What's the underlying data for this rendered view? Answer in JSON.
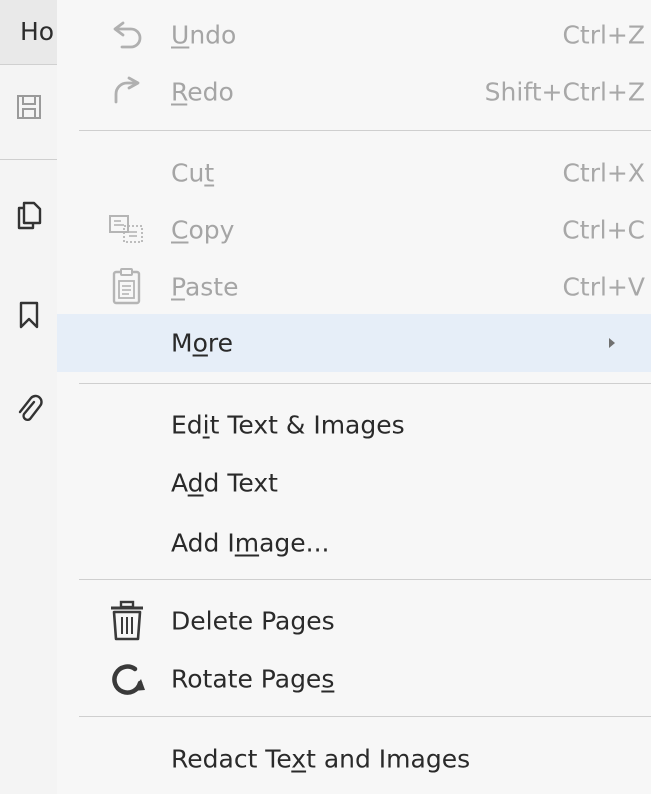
{
  "app": {
    "home_tab_label": "Ho",
    "strip_icons": [
      "save-icon",
      "pages-icon",
      "bookmark-icon",
      "attachment-icon"
    ]
  },
  "menu": {
    "items": [
      {
        "pre": "",
        "key": "U",
        "post": "ndo",
        "shortcut": "Ctrl+Z",
        "icon": "undo-icon",
        "disabled": true
      },
      {
        "pre": "",
        "key": "R",
        "post": "edo",
        "shortcut": "Shift+Ctrl+Z",
        "icon": "redo-icon",
        "disabled": true
      },
      {
        "pre": "Cu",
        "key": "t",
        "post": "",
        "shortcut": "Ctrl+X",
        "icon": "",
        "disabled": true
      },
      {
        "pre": "",
        "key": "C",
        "post": "opy",
        "shortcut": "Ctrl+C",
        "icon": "copy-icon",
        "disabled": true
      },
      {
        "pre": "",
        "key": "P",
        "post": "aste",
        "shortcut": "Ctrl+V",
        "icon": "paste-icon",
        "disabled": true
      },
      {
        "pre": "M",
        "key": "o",
        "post": "re",
        "shortcut": "",
        "icon": "",
        "disabled": false,
        "submenu": true,
        "highlighted": true
      },
      {
        "pre": "Ed",
        "key": "i",
        "post": "t Text & Images",
        "shortcut": "",
        "icon": "",
        "disabled": false
      },
      {
        "pre": "A",
        "key": "d",
        "post": "d Text",
        "shortcut": "",
        "icon": "",
        "disabled": false
      },
      {
        "pre": "Add I",
        "key": "m",
        "post": "age...",
        "shortcut": "",
        "icon": "",
        "disabled": false
      },
      {
        "pre": "Delete Pages",
        "key": "",
        "post": "",
        "shortcut": "",
        "icon": "trash-icon",
        "disabled": false
      },
      {
        "pre": "Rotate Page",
        "key": "s",
        "post": "",
        "shortcut": "",
        "icon": "rotate-icon",
        "disabled": false
      },
      {
        "pre": "Redact Te",
        "key": "x",
        "post": "t and Images",
        "shortcut": "",
        "icon": "",
        "disabled": false
      }
    ]
  },
  "colors": {
    "menu_bg": "#f7f7f7",
    "hover_bg": "#e6eef8",
    "text": "#2a2a2a",
    "disabled_text": "#a5a5a5",
    "separator": "#cfcfcf"
  }
}
